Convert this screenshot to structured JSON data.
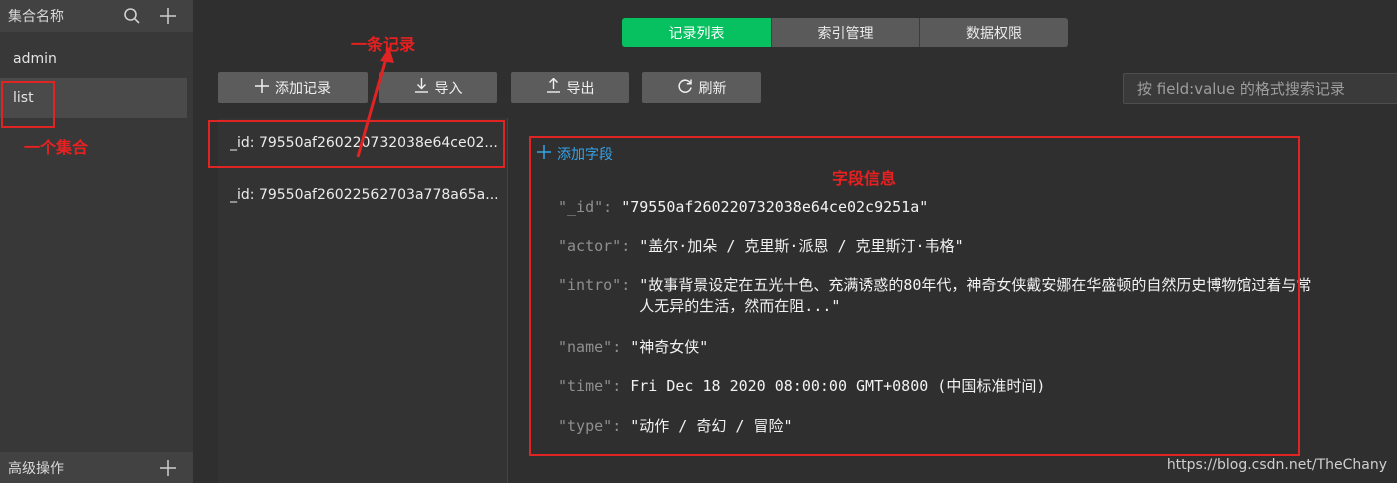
{
  "sidebar": {
    "header_title": "集合名称",
    "items": [
      {
        "label": "admin"
      },
      {
        "label": "list"
      }
    ],
    "footer_title": "高级操作"
  },
  "tabs": [
    {
      "label": "记录列表"
    },
    {
      "label": "索引管理"
    },
    {
      "label": "数据权限"
    }
  ],
  "toolbar": {
    "add_record": "添加记录",
    "import": "导入",
    "export": "导出",
    "refresh": "刷新"
  },
  "search": {
    "placeholder": "按 field:value 的格式搜索记录"
  },
  "records": [
    {
      "label": "_id: 79550af260220732038e64ce02..."
    },
    {
      "label": "_id: 79550af26022562703a778a65a..."
    }
  ],
  "detail": {
    "add_field": "添加字段",
    "fields": [
      {
        "key": "\"_id\"",
        "value": "\"79550af260220732038e64ce02c9251a\""
      },
      {
        "key": "\"actor\"",
        "value": "\"盖尔·加朵 / 克里斯·派恩 / 克里斯汀·韦格\""
      },
      {
        "key": "\"intro\"",
        "value": "\"故事背景设定在五光十色、充满诱惑的80年代，神奇女侠戴安娜在华盛顿的自然历史博物馆过着与常\n人无异的生活，然而在阻...\""
      },
      {
        "key": "\"name\"",
        "value": "\"神奇女侠\""
      },
      {
        "key": "\"time\"",
        "value": "Fri Dec 18 2020 08:00:00 GMT+0800 (中国标准时间)"
      },
      {
        "key": "\"type\"",
        "value": "\"动作 / 奇幻 / 冒险\""
      }
    ]
  },
  "annotations": {
    "one_record": "一条记录",
    "one_collection": "一个集合",
    "field_info": "字段信息"
  },
  "watermark": "https://blog.csdn.net/TheChany",
  "colors": {
    "accent_green": "#07c160",
    "link_blue": "#35a3e8",
    "annotation_red": "#e02323"
  }
}
